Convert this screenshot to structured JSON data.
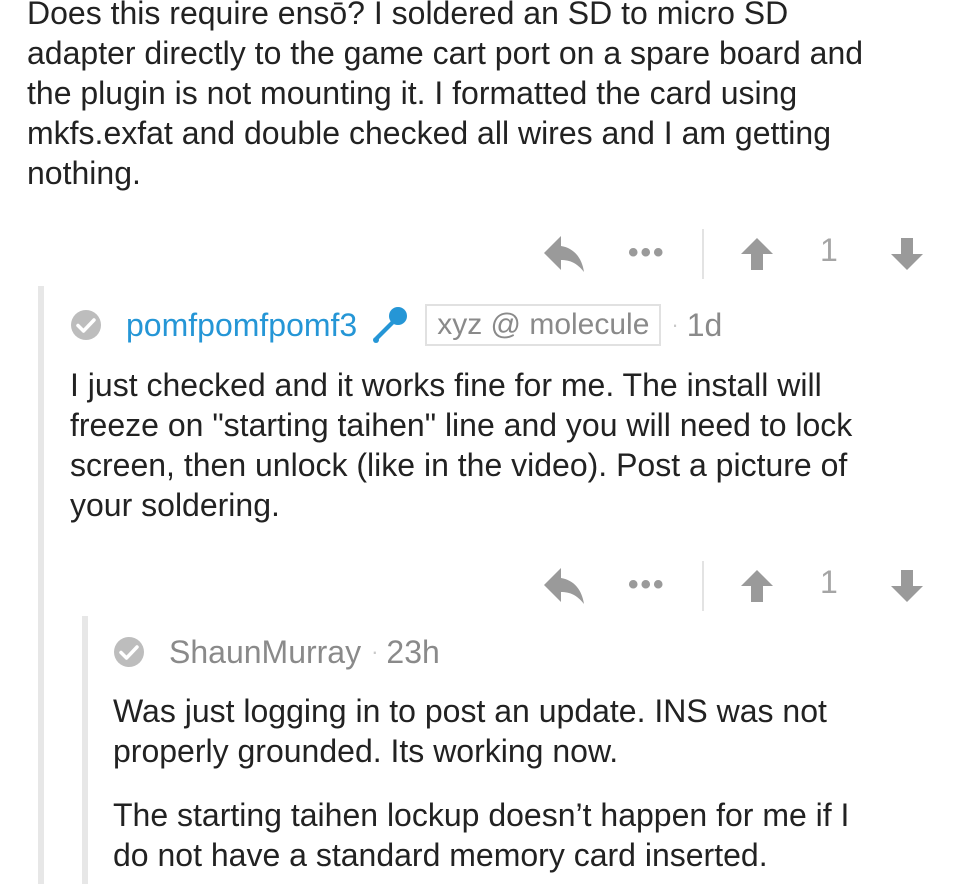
{
  "colors": {
    "text": "#222222",
    "muted": "#8a8a8a",
    "icon": "#9a9a9a",
    "username_link": "#2596d6",
    "thread_line": "#e7e7e7"
  },
  "comments": [
    {
      "body_lines": [
        "Does this require ensō? I soldered an SD to micro SD",
        "adapter directly to the game cart port on a spare board and",
        "the plugin is not mounting it. I formatted the card using",
        "mkfs.exfat and double checked all wires and I am getting",
        "nothing."
      ],
      "score": "1",
      "icons": {
        "reply": "reply-arrow-icon",
        "more": "more-dots-icon",
        "upvote": "upvote-arrow-icon",
        "downvote": "downvote-arrow-icon"
      }
    },
    {
      "username": "pomfpomfpomf3",
      "badge_icon": "microphone-icon",
      "flair": "xyz @ molecule",
      "separator": "·",
      "age": "1d",
      "body_lines": [
        "I just checked and it works fine for me. The install will",
        "freeze on \"starting taihen\" line and you will need to lock",
        "screen, then unlock (like in the video). Post a picture of",
        "your soldering."
      ],
      "score": "1"
    },
    {
      "username": "ShaunMurray",
      "separator": "·",
      "age": "23h",
      "paragraphs": [
        [
          "Was just logging in to post an update. INS was not",
          "properly grounded. Its working now."
        ],
        [
          "The starting taihen lockup doesn’t happen for me if I",
          "do not have a standard memory card inserted."
        ]
      ]
    }
  ]
}
